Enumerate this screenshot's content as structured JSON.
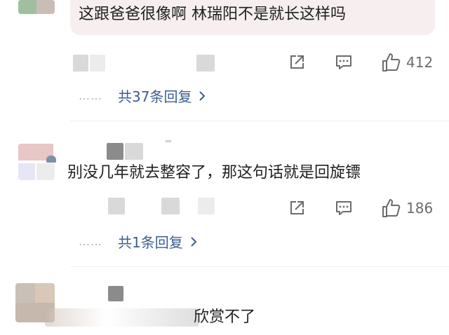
{
  "comments": [
    {
      "text": "这跟爸爸很像啊 林瑞阳不是就长这样吗",
      "likes": "412",
      "replies": "共37条回复"
    },
    {
      "text": "别没几年就去整容了，那这句话就是回旋镖",
      "likes": "186",
      "replies": "共1条回复"
    },
    {
      "text": "欣赏不了"
    }
  ],
  "icons": {
    "share": "share-icon",
    "comment": "comment-icon",
    "like": "thumbs-up-icon",
    "chevron": "chevron-right-icon"
  },
  "colors": {
    "reply_link": "#3a5f8f",
    "bubble_bg": "#f6eeef",
    "icon_gray": "#6b6b6b"
  }
}
